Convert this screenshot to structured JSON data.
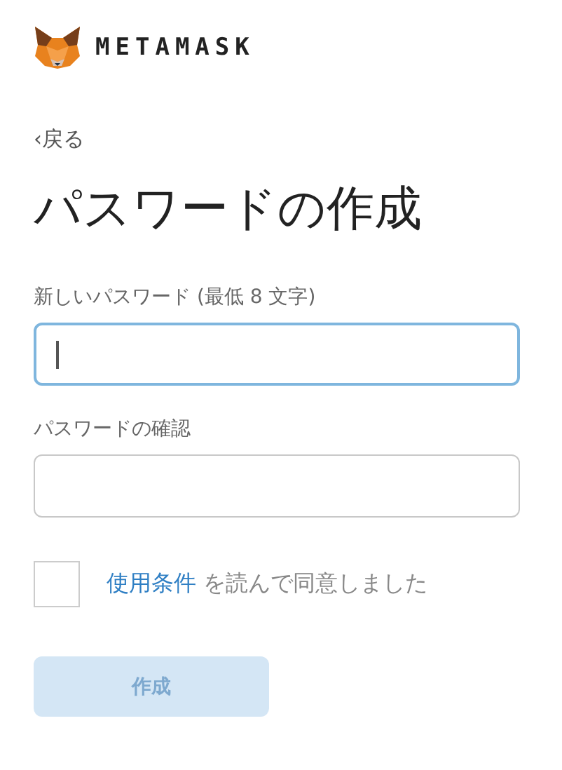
{
  "header": {
    "brand": "METAMASK"
  },
  "back_link": "‹戻る",
  "title": "パスワードの作成",
  "fields": [
    {
      "label": "新しいパスワード (最低 8 文字)",
      "focused": true
    },
    {
      "label": "パスワードの確認",
      "focused": false
    }
  ],
  "agreement": {
    "checked": false,
    "link": "使用条件",
    "text": " を読んで同意しました"
  },
  "submit_button": {
    "label": "作成",
    "disabled": true
  }
}
